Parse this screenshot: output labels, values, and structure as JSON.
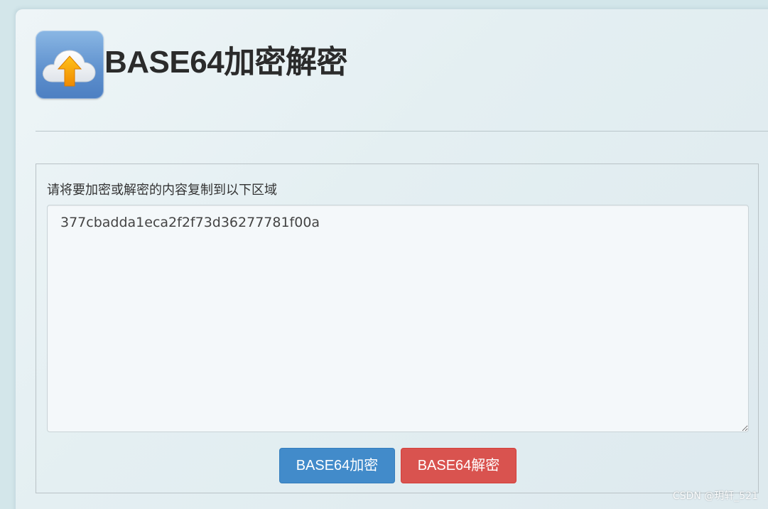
{
  "header": {
    "logo_icon": "cloud-upload-icon",
    "title": "BASE64加密解密"
  },
  "form": {
    "label": "请将要加密或解密的内容复制到以下区域",
    "textarea_value": "377cbadda1eca2f2f73d36277781f00a"
  },
  "actions": {
    "encrypt_label": "BASE64加密",
    "decrypt_label": "BASE64解密"
  },
  "watermark": "CSDN @玥轩_521",
  "colors": {
    "encrypt_button": "#428bca",
    "decrypt_button": "#d9534f",
    "background": "#d3e6ea"
  }
}
